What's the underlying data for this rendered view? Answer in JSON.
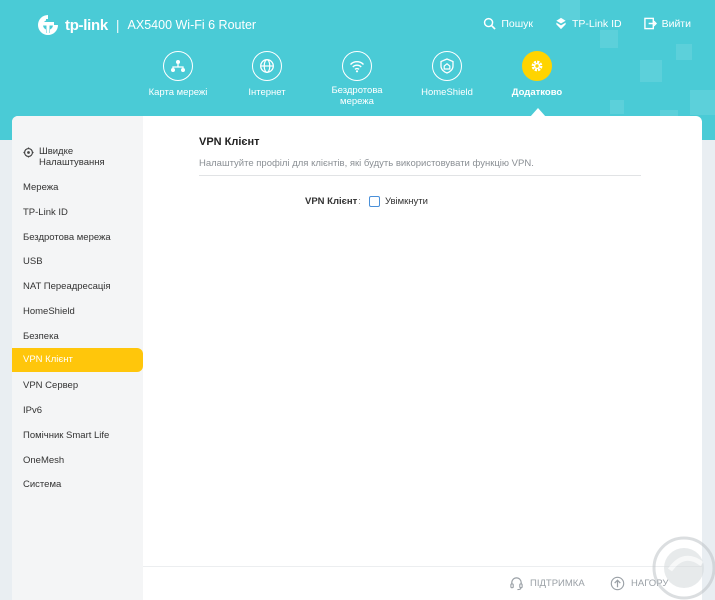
{
  "header": {
    "brand": "tp-link",
    "separator": "|",
    "model": "AX5400 Wi-Fi 6 Router",
    "links": [
      {
        "label": "Пошук",
        "icon": "search-icon"
      },
      {
        "label": "TP-Link ID",
        "icon": "tplink-id-icon"
      },
      {
        "label": "Вийти",
        "icon": "logout-icon"
      }
    ]
  },
  "nav": {
    "items": [
      {
        "label": "Карта мережі",
        "icon": "network-map-icon"
      },
      {
        "label": "Інтернет",
        "icon": "globe-icon"
      },
      {
        "label": "Бездротова мережа",
        "icon": "wifi-icon"
      },
      {
        "label": "HomeShield",
        "icon": "homeshield-icon"
      },
      {
        "label": "Додатково",
        "icon": "gear-icon",
        "active": true
      }
    ]
  },
  "sidebar": {
    "items": [
      {
        "label": "Швидке Налаштування",
        "icon": "quick-setup-icon"
      },
      {
        "label": "Мережа"
      },
      {
        "label": "TP-Link ID"
      },
      {
        "label": "Бездротова мережа"
      },
      {
        "label": "USB"
      },
      {
        "label": "NAT Переадресація"
      },
      {
        "label": "HomeShield"
      },
      {
        "label": "Безпека"
      },
      {
        "label": "VPN Клієнт",
        "active": true
      },
      {
        "label": "VPN Сервер"
      },
      {
        "label": "IPv6"
      },
      {
        "label": "Помічник Smart Life"
      },
      {
        "label": "OneMesh"
      },
      {
        "label": "Система"
      }
    ]
  },
  "main": {
    "title": "VPN Клієнт",
    "description": "Налаштуйте профілі для клієнтів, які будуть використовувати функцію VPN.",
    "vpn_label": "VPN Клієнт",
    "colon": ":",
    "enable_label": "Увімкнути",
    "enabled": false
  },
  "footer": {
    "support_label": "ПІДТРИМКА",
    "top_label": "НАГОРУ"
  },
  "colors": {
    "header_bg": "#4acbd6",
    "accent": "#ffc60b",
    "active_circle": "#ffd400"
  }
}
